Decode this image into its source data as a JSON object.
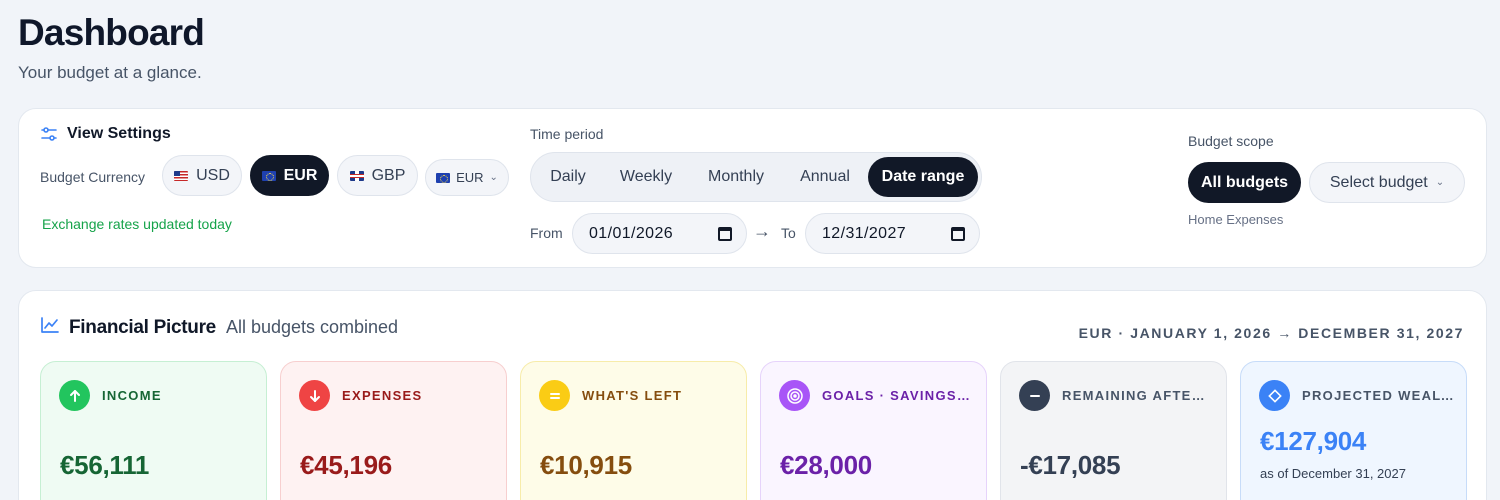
{
  "header": {
    "title": "Dashboard",
    "subtitle": "Your budget at a glance."
  },
  "view_settings": {
    "title": "View Settings",
    "currency_label": "Budget Currency",
    "currencies": [
      {
        "code": "USD",
        "flag": "us-flag-icon"
      },
      {
        "code": "EUR",
        "flag": "eu-flag-icon",
        "active": true
      },
      {
        "code": "GBP",
        "flag": "gb-flag-icon"
      }
    ],
    "currency_select": "EUR",
    "exchange_note": "Exchange rates updated today"
  },
  "time_period": {
    "label": "Time period",
    "options": [
      "Daily",
      "Weekly",
      "Monthly",
      "Annual",
      "Date range"
    ],
    "active": "Date range",
    "from_label": "From",
    "from_value": "01/01/2026",
    "to_label": "To",
    "to_value": "12/31/2027"
  },
  "budget_scope": {
    "label": "Budget scope",
    "all_label": "All budgets",
    "select_label": "Select budget",
    "sub_label": "Home Expenses"
  },
  "financial_picture": {
    "title": "Financial Picture",
    "subtitle": "All budgets combined",
    "range": "EUR · JANUARY 1, 2026 → DECEMBER 31, 2027",
    "stats": [
      {
        "label": "INCOME",
        "value": "€56,111",
        "icon": "arrow-up-icon"
      },
      {
        "label": "EXPENSES",
        "value": "€45,196",
        "icon": "arrow-down-icon"
      },
      {
        "label": "WHAT'S LEFT",
        "value": "€10,915",
        "icon": "equals-icon"
      },
      {
        "label": "GOALS · SAVINGS & INVESTMENTS",
        "value": "€28,000",
        "icon": "target-icon"
      },
      {
        "label": "REMAINING AFTER GOALS",
        "value": "-€17,085",
        "icon": "minus-icon"
      },
      {
        "label": "PROJECTED WEALTH",
        "value": "€127,904",
        "note": "as of December 31, 2027",
        "icon": "diamond-icon"
      }
    ]
  },
  "colors": {
    "income": "#16a34a",
    "expenses": "#ef4444",
    "whats_left": "#facc15",
    "goals": "#a855f7",
    "remaining": "#344054",
    "projected": "#3b82f6"
  }
}
